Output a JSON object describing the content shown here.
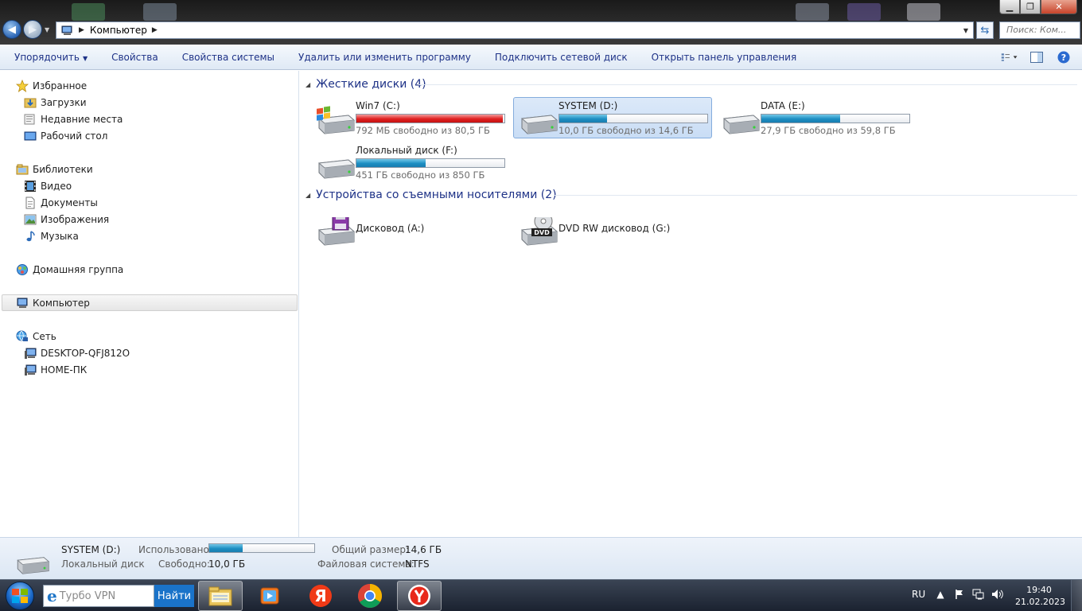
{
  "window": {
    "address": {
      "location": "Компьютер"
    },
    "search_placeholder": "Поиск: Ком..."
  },
  "toolbar": {
    "organize": "Упорядочить",
    "properties": "Свойства",
    "system_properties": "Свойства системы",
    "uninstall": "Удалить или изменить программу",
    "map_drive": "Подключить сетевой диск",
    "control_panel": "Открыть панель управления"
  },
  "sidebar": {
    "favorites": "Избранное",
    "favorites_items": [
      "Загрузки",
      "Недавние места",
      "Рабочий стол"
    ],
    "libraries": "Библиотеки",
    "libraries_items": [
      "Видео",
      "Документы",
      "Изображения",
      "Музыка"
    ],
    "homegroup": "Домашняя группа",
    "computer": "Компьютер",
    "network": "Сеть",
    "network_items": [
      "DESKTOP-QFJ812O",
      "HOME-ПК"
    ]
  },
  "groups": {
    "hard_drives": "Жесткие диски (4)",
    "removable": "Устройства со съемными носителями (2)"
  },
  "drives": [
    {
      "name": "Win7 (C:)",
      "free_text": "792 МБ свободно из 80,5 ГБ",
      "used_fraction": 0.99,
      "bar_color": "#e02020"
    },
    {
      "name": "SYSTEM (D:)",
      "free_text": "10,0 ГБ свободно из 14,6 ГБ",
      "used_fraction": 0.32,
      "bar_color": "#1c8ec2",
      "selected": true
    },
    {
      "name": "DATA (E:)",
      "free_text": "27,9 ГБ свободно из 59,8 ГБ",
      "used_fraction": 0.53,
      "bar_color": "#1c8ec2"
    },
    {
      "name": "Локальный диск  (F:)",
      "free_text": "451 ГБ свободно из 850 ГБ",
      "used_fraction": 0.47,
      "bar_color": "#1c8ec2"
    }
  ],
  "removable": [
    {
      "name": "Дисковод (A:)",
      "icon": "floppy-drive-icon"
    },
    {
      "name": "DVD RW дисковод (G:)",
      "icon": "dvd-drive-icon",
      "badge": "DVD"
    }
  ],
  "details": {
    "name": "SYSTEM (D:)",
    "type": "Локальный диск",
    "used_label": "Использовано:",
    "used_fraction": 0.32,
    "free_label": "Свободно:",
    "free_value": "10,0 ГБ",
    "total_label": "Общий размер:",
    "total_value": "14,6 ГБ",
    "fs_label": "Файловая система:",
    "fs_value": "NTFS"
  },
  "taskbar": {
    "search_placeholder": "Турбо VPN",
    "search_button": "Найти",
    "apps": [
      "file-explorer-icon",
      "media-player-icon",
      "yandex-browser-icon",
      "chrome-icon",
      "yandex-app-icon"
    ],
    "language": "RU",
    "time": "19:40",
    "date": "21.02.2023"
  }
}
